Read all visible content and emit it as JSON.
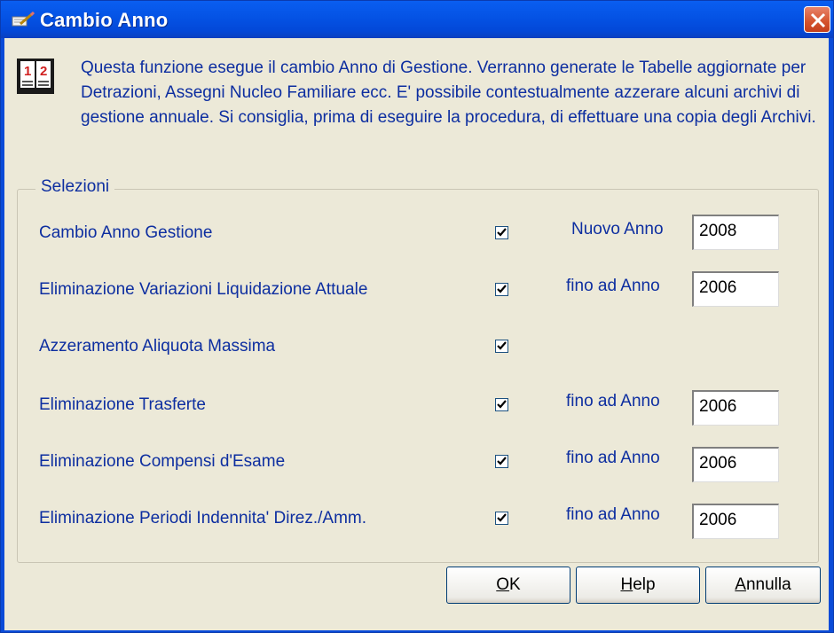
{
  "window": {
    "title": "Cambio Anno"
  },
  "intro": {
    "text": "Questa funzione esegue il cambio Anno di Gestione. Verranno generate le Tabelle aggiornate per Detrazioni, Assegni Nucleo Familiare ecc. E' possibile contestualmente azzerare alcuni archivi di gestione annuale. Si consiglia, prima di eseguire la procedura, di effettuare una copia degli Archivi."
  },
  "group": {
    "label": "Selezioni",
    "rows": [
      {
        "label": "Cambio Anno Gestione",
        "checked": true,
        "year_label": "Nuovo Anno",
        "year": "2008"
      },
      {
        "label": "Eliminazione Variazioni Liquidazione Attuale",
        "checked": true,
        "year_label": "fino ad Anno",
        "year": "2006"
      },
      {
        "label": "Azzeramento Aliquota Massima",
        "checked": true
      },
      {
        "label": "Eliminazione Trasferte",
        "checked": true,
        "year_label": "fino ad Anno",
        "year": "2006"
      },
      {
        "label": "Eliminazione Compensi d'Esame",
        "checked": true,
        "year_label": "fino ad Anno",
        "year": "2006"
      },
      {
        "label": "Eliminazione Periodi Indennita' Direz./Amm.",
        "checked": true,
        "year_label": "fino ad Anno",
        "year": "2006"
      }
    ]
  },
  "buttons": {
    "ok": {
      "accel": "O",
      "rest": "K"
    },
    "help": {
      "accel": "H",
      "rest": "elp"
    },
    "cancel": {
      "accel": "A",
      "rest": "nnulla"
    }
  },
  "colors": {
    "titlebar": "#0554e6",
    "client_bg": "#ece9d8",
    "text": "#0d2ea0",
    "close_button": "#d4522c"
  },
  "icons": {
    "title": "pencil-paper-icon",
    "info": "book-1-2-icon",
    "close": "close-icon",
    "check": "check-icon"
  }
}
